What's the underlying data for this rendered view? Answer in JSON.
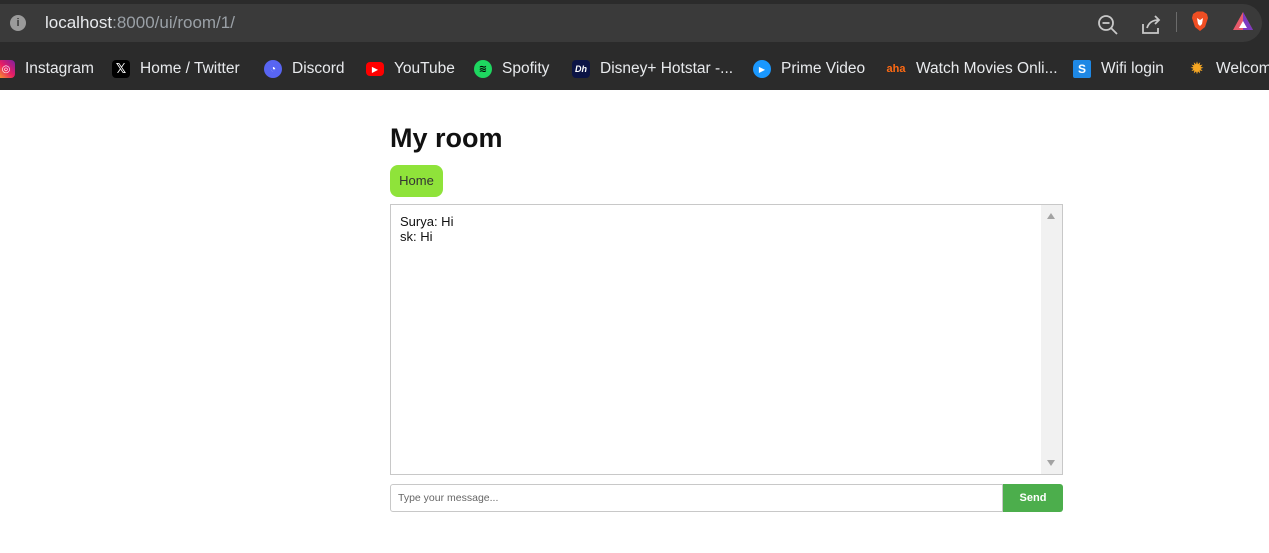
{
  "browser": {
    "url_host": "localhost",
    "url_path": ":8000/ui/room/1/",
    "bookmarks": [
      {
        "label": "Instagram",
        "icon": "instagram-icon"
      },
      {
        "label": "Home / Twitter",
        "icon": "x-twitter-icon"
      },
      {
        "label": "Discord",
        "icon": "discord-icon"
      },
      {
        "label": "YouTube",
        "icon": "youtube-icon"
      },
      {
        "label": "Spofity",
        "icon": "spotify-icon"
      },
      {
        "label": "Disney+ Hotstar -...",
        "icon": "hotstar-icon"
      },
      {
        "label": "Prime Video",
        "icon": "prime-video-icon"
      },
      {
        "label": "Watch Movies Onli...",
        "icon": "aha-icon"
      },
      {
        "label": "Wifi login",
        "icon": "wifi-login-icon"
      },
      {
        "label": "Welcom",
        "icon": "sun-icon"
      }
    ]
  },
  "page": {
    "title": "My room",
    "home_label": "Home",
    "messages": [
      "Surya: Hi",
      "sk: Hi"
    ],
    "input_placeholder": "Type your message...",
    "send_label": "Send"
  }
}
